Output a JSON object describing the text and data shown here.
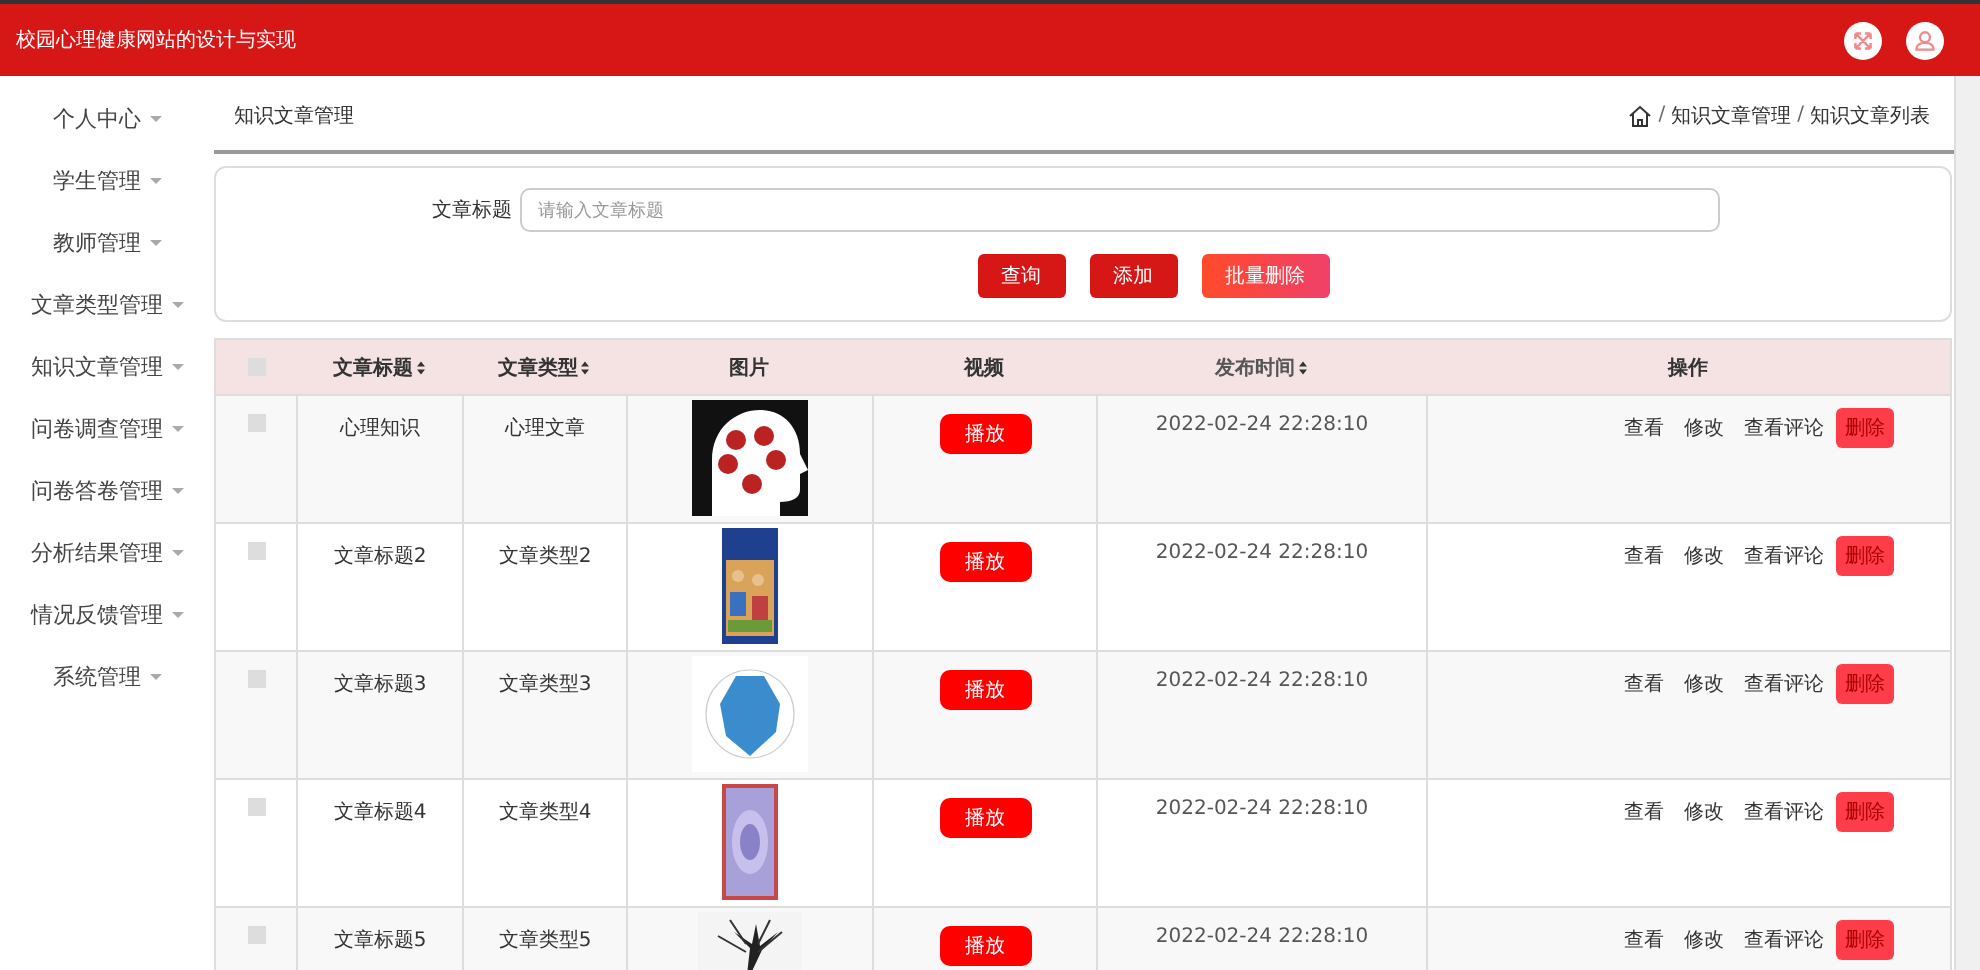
{
  "header": {
    "title": "校园心理健康网站的设计与实现"
  },
  "sidebar": {
    "items": [
      {
        "label": "个人中心"
      },
      {
        "label": "学生管理"
      },
      {
        "label": "教师管理"
      },
      {
        "label": "文章类型管理"
      },
      {
        "label": "知识文章管理"
      },
      {
        "label": "问卷调查管理"
      },
      {
        "label": "问卷答卷管理"
      },
      {
        "label": "分析结果管理"
      },
      {
        "label": "情况反馈管理"
      },
      {
        "label": "系统管理"
      }
    ]
  },
  "page_title": "知识文章管理",
  "breadcrumb": [
    {
      "separator": "/",
      "label": "知识文章管理"
    },
    {
      "separator": "/",
      "label": "知识文章列表"
    }
  ],
  "search": {
    "label": "文章标题",
    "placeholder": "请输入文章标题",
    "buttons": [
      {
        "label": "查询",
        "kind": "primary"
      },
      {
        "label": "添加",
        "kind": "primary"
      },
      {
        "label": "批量删除",
        "kind": "danger"
      }
    ]
  },
  "table": {
    "select_all": {
      "checked": false
    },
    "columns": [
      {
        "label": "文章标题",
        "sortable": true
      },
      {
        "label": "文章类型",
        "sortable": true
      },
      {
        "label": "图片",
        "sortable": false
      },
      {
        "label": "视频",
        "sortable": false
      },
      {
        "label": "发布时间",
        "sortable": true
      },
      {
        "label": "操作",
        "sortable": false
      }
    ],
    "rows": [
      {
        "checked": false,
        "title": "心理知识",
        "type": "心理文章",
        "video_button": "播放",
        "time": "2022-02-24 22:28:10",
        "actions": [
          "查看",
          "修改",
          "查看评论"
        ],
        "delete_button": "删除"
      },
      {
        "checked": false,
        "title": "文章标题2",
        "type": "文章类型2",
        "video_button": "播放",
        "time": "2022-02-24 22:28:10",
        "actions": [
          "查看",
          "修改",
          "查看评论"
        ],
        "delete_button": "删除"
      },
      {
        "checked": false,
        "title": "文章标题3",
        "type": "文章类型3",
        "video_button": "播放",
        "time": "2022-02-24 22:28:10",
        "actions": [
          "查看",
          "修改",
          "查看评论"
        ],
        "delete_button": "删除"
      },
      {
        "checked": false,
        "title": "文章标题4",
        "type": "文章类型4",
        "video_button": "播放",
        "time": "2022-02-24 22:28:10",
        "actions": [
          "查看",
          "修改",
          "查看评论"
        ],
        "delete_button": "删除"
      },
      {
        "checked": false,
        "title": "文章标题5",
        "type": "文章类型5",
        "video_button": "播放",
        "time": "2022-02-24 22:28:10",
        "actions": [
          "查看",
          "修改",
          "查看评论"
        ],
        "delete_button": "删除"
      }
    ]
  }
}
